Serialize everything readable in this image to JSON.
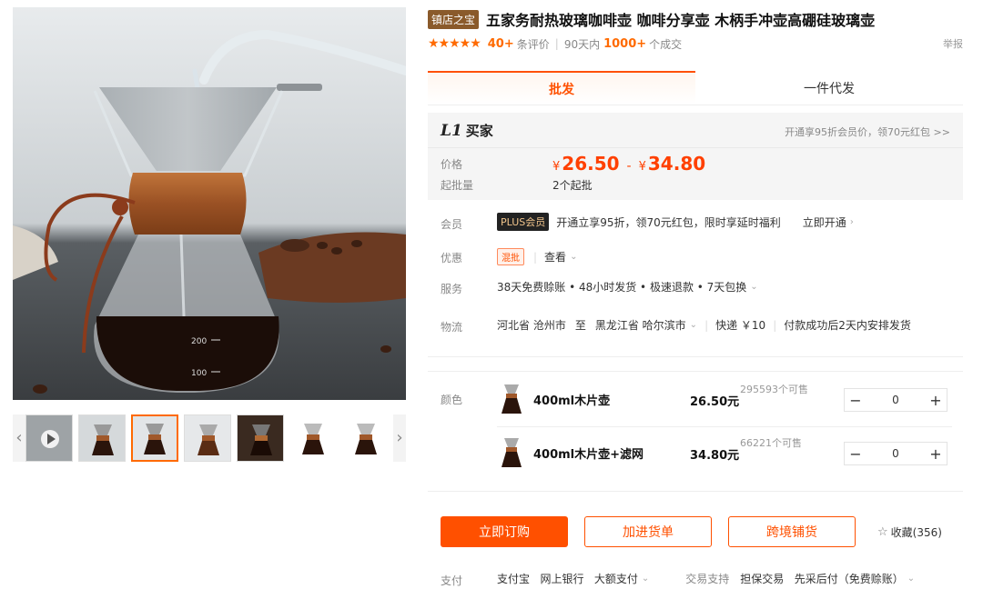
{
  "gallery": {
    "main_image": "coffee-pot-product-photo",
    "thumbnails": [
      "video-thumb",
      "pot-thumb-1",
      "pot-thumb-2",
      "pot-thumb-3",
      "pot-thumb-4",
      "pot-thumb-5",
      "pot-thumb-6"
    ],
    "prev": "‹",
    "next": "›"
  },
  "product": {
    "shop_badge": "镇店之宝",
    "title": "五家务耐热玻璃咖啡壶 咖啡分享壶 木柄手冲壶高硼硅玻璃壶",
    "rating_stars": 5,
    "review_count": "40+",
    "review_label": "条评价",
    "period": "90天内",
    "sold_count": "1000+",
    "sold_label": "个成交",
    "report": "举报"
  },
  "tabs": [
    {
      "label": "批发",
      "active": true
    },
    {
      "label": "一件代发",
      "active": false
    }
  ],
  "price_box": {
    "level": "L1",
    "level_text": "买家",
    "promo": "开通享95折会员价，领70元红包 >>",
    "price_label": "价格",
    "price_currency": "¥",
    "price_min": "26.50",
    "price_max": "34.80",
    "moq_label": "起批量",
    "moq_value": "2个起批"
  },
  "membership": {
    "label": "会员",
    "badge": "PLUS会员",
    "text": "开通立享95折，领70元红包，限时享延时福利",
    "link": "立即开通"
  },
  "discount": {
    "label": "优惠",
    "tag": "混批",
    "view": "查看"
  },
  "service": {
    "label": "服务",
    "text": "38天免费赊账 • 48小时发货 • 极速退款 • 7天包换"
  },
  "logistics": {
    "label": "物流",
    "from": "河北省 沧州市",
    "to_word": "至",
    "to": "黑龙江省 哈尔滨市",
    "express": "快递 ￥10",
    "note": "付款成功后2天内安排发货"
  },
  "sku": {
    "label": "颜色",
    "items": [
      {
        "name": "400ml木片壶",
        "price": "26.50元",
        "stock": "295593个可售",
        "qty": "0"
      },
      {
        "name": "400ml木片壶+滤网",
        "price": "34.80元",
        "stock": "66221个可售",
        "qty": "0"
      }
    ]
  },
  "actions": {
    "order": "立即订购",
    "add_cart": "加进货单",
    "cross_border": "跨境铺货",
    "favorite": "收藏(356)"
  },
  "payment": {
    "label": "支付",
    "methods": "支付宝   网上银行   大额支付",
    "trade_label": "交易支持",
    "trade": "担保交易   先采后付（免费赊账）"
  },
  "colors": {
    "accent": "#ff5000",
    "brand_dark": "#8a5a2b"
  }
}
